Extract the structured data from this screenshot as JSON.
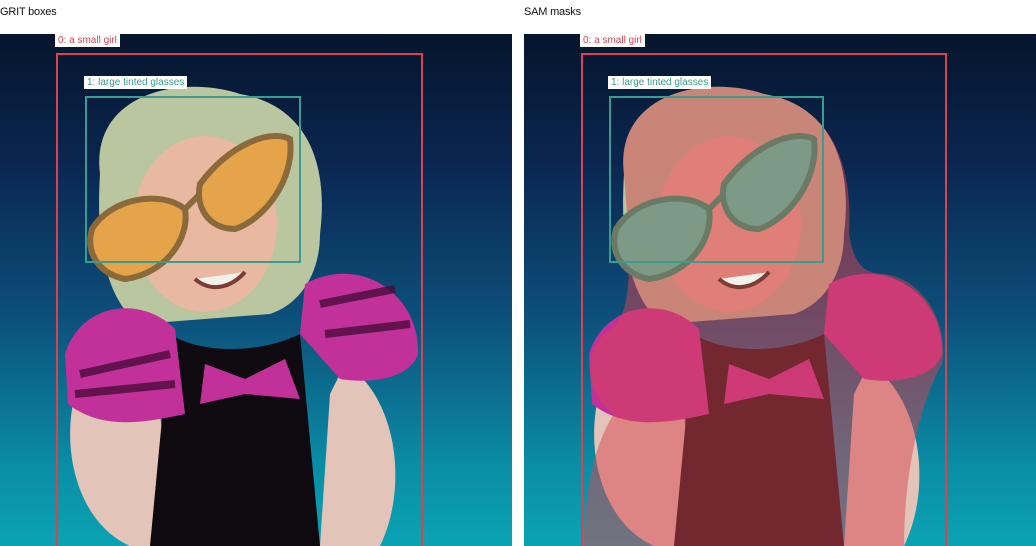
{
  "panels": {
    "left": {
      "title": "GRIT boxes"
    },
    "right": {
      "title": "SAM masks"
    }
  },
  "detections": [
    {
      "id": 0,
      "label": "0: a small girl",
      "color": "#d8434f"
    },
    {
      "id": 1,
      "label": "1: large tinted glasses",
      "color": "#3a9b8f"
    }
  ]
}
